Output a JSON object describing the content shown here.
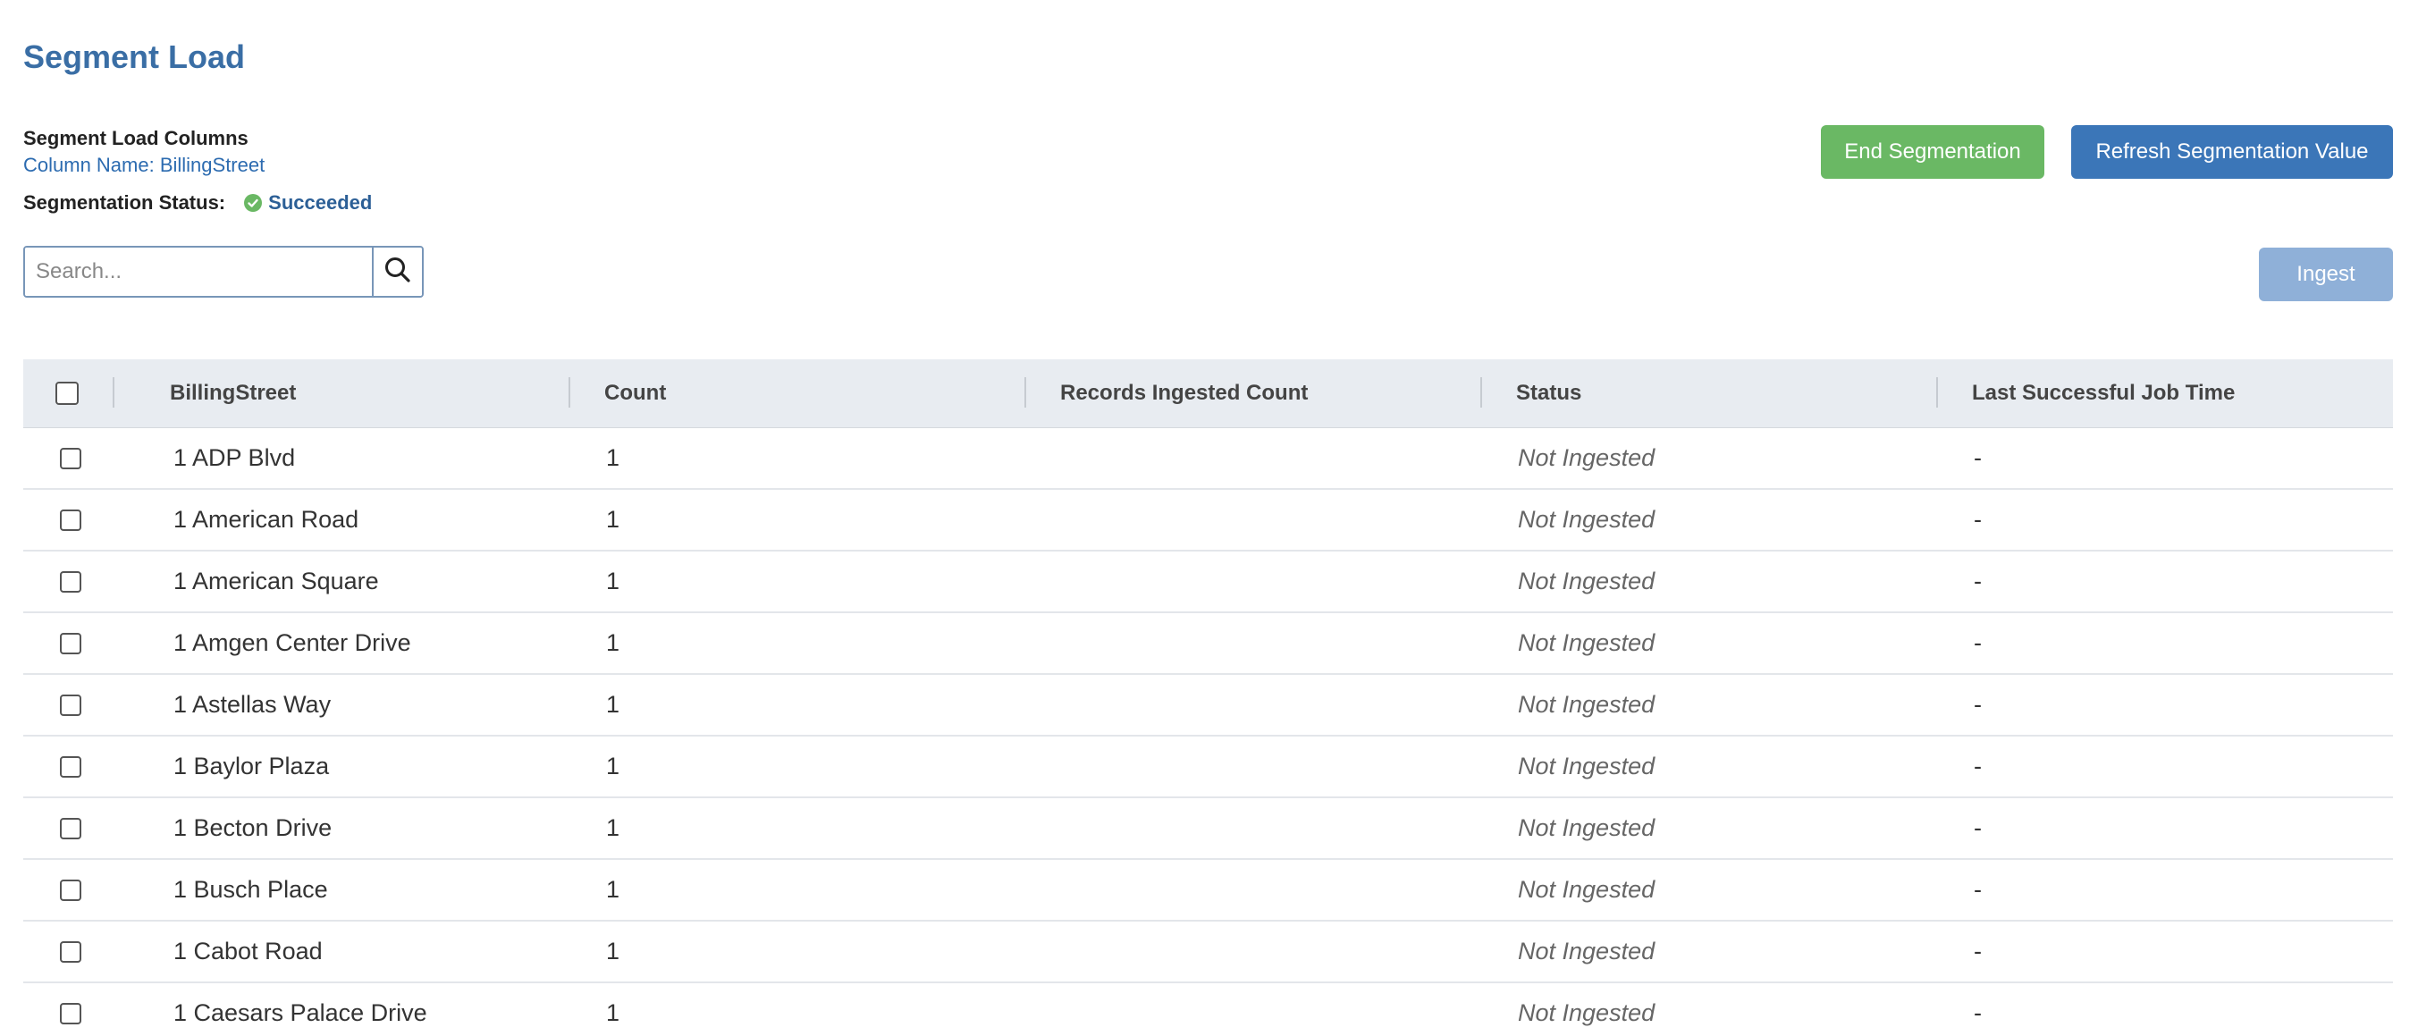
{
  "page": {
    "title": "Segment Load"
  },
  "info": {
    "heading": "Segment Load Columns",
    "column_name": "Column Name: BillingStreet",
    "status_label": "Segmentation Status:",
    "status_value": "Succeeded"
  },
  "buttons": {
    "end_segmentation": "End Segmentation",
    "refresh_segmentation": "Refresh Segmentation Value",
    "ingest": "Ingest"
  },
  "search": {
    "placeholder": "Search..."
  },
  "colors": {
    "title": "#3a6ea5",
    "success": "#6ab864",
    "primary": "#3b76b8",
    "disabled_primary": "#8fb0d8"
  },
  "table": {
    "columns": [
      "BillingStreet",
      "Count",
      "Records Ingested Count",
      "Status",
      "Last Successful Job Time"
    ],
    "rows": [
      {
        "street": "1 ADP Blvd",
        "count": "1",
        "ingested": "",
        "status": "Not Ingested",
        "last_job": "-"
      },
      {
        "street": "1 American Road",
        "count": "1",
        "ingested": "",
        "status": "Not Ingested",
        "last_job": "-"
      },
      {
        "street": "1 American Square",
        "count": "1",
        "ingested": "",
        "status": "Not Ingested",
        "last_job": "-"
      },
      {
        "street": "1 Amgen Center Drive",
        "count": "1",
        "ingested": "",
        "status": "Not Ingested",
        "last_job": "-"
      },
      {
        "street": "1 Astellas Way",
        "count": "1",
        "ingested": "",
        "status": "Not Ingested",
        "last_job": "-"
      },
      {
        "street": "1 Baylor Plaza",
        "count": "1",
        "ingested": "",
        "status": "Not Ingested",
        "last_job": "-"
      },
      {
        "street": "1 Becton Drive",
        "count": "1",
        "ingested": "",
        "status": "Not Ingested",
        "last_job": "-"
      },
      {
        "street": "1 Busch Place",
        "count": "1",
        "ingested": "",
        "status": "Not Ingested",
        "last_job": "-"
      },
      {
        "street": "1 Cabot Road",
        "count": "1",
        "ingested": "",
        "status": "Not Ingested",
        "last_job": "-"
      },
      {
        "street": "1 Caesars Palace Drive",
        "count": "1",
        "ingested": "",
        "status": "Not Ingested",
        "last_job": "-"
      }
    ]
  }
}
